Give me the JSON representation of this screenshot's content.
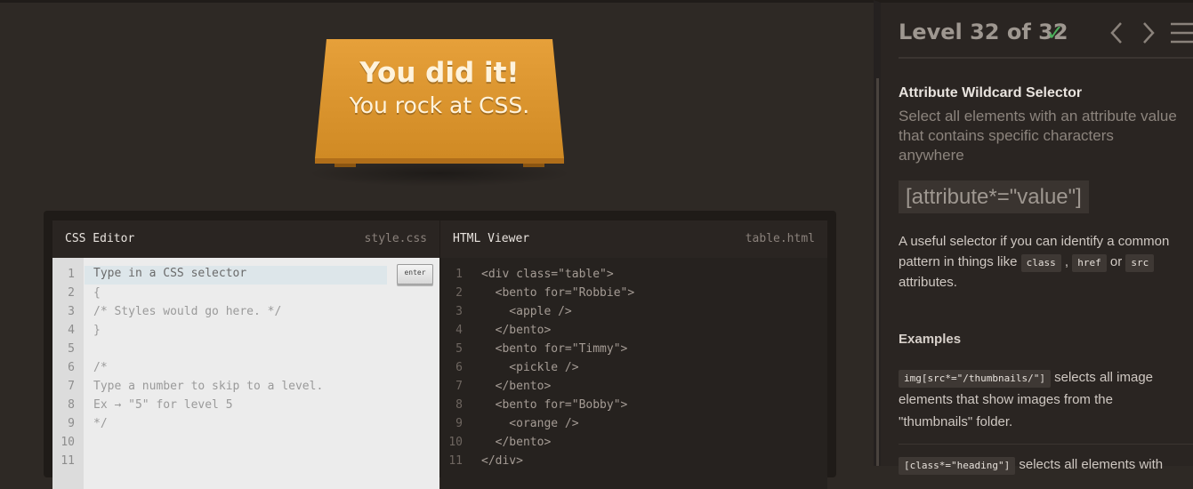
{
  "win": {
    "title": "You did it!",
    "subtitle": "You rock at CSS."
  },
  "css_editor": {
    "title": "CSS Editor",
    "file": "style.css",
    "input_placeholder": "Type in a CSS selector",
    "enter_label": "enter",
    "lines": [
      "{",
      "/* Styles would go here. */",
      "}",
      "",
      "/*",
      "Type a number to skip to a level.",
      "Ex → \"5\" for level 5",
      "*/",
      "",
      ""
    ],
    "line_numbers": [
      "1",
      "2",
      "3",
      "4",
      "5",
      "6",
      "7",
      "8",
      "9",
      "10",
      "11"
    ]
  },
  "html_viewer": {
    "title": "HTML Viewer",
    "file": "table.html",
    "lines": [
      "<div class=\"table\">",
      "  <bento for=\"Robbie\">",
      "    <apple />",
      "  </bento>",
      "  <bento for=\"Timmy\">",
      "    <pickle />",
      "  </bento>",
      "  <bento for=\"Bobby\">",
      "    <orange />",
      "  </bento>",
      "</div>"
    ],
    "line_numbers": [
      "1",
      "2",
      "3",
      "4",
      "5",
      "6",
      "7",
      "8",
      "9",
      "10",
      "11"
    ]
  },
  "sidebar": {
    "level": "Level 32 of 32",
    "title": "Attribute Wildcard Selector",
    "description": "Select all elements with an attribute value that contains specific characters anywhere",
    "syntax": "[attribute*=\"value\"]",
    "help_before": "A useful selector if you can identify a common pattern in things like ",
    "help_tags": [
      "class",
      "href",
      "src"
    ],
    "help_after": "attributes.",
    "examples_heading": "Examples",
    "example1_code": "img[src*=\"/thumbnails/\"]",
    "example1_text": " selects all image elements that show images from the \"thumbnails\" folder.",
    "example2_code": "[class*=\"heading\"]",
    "example2_text": " selects all elements with"
  },
  "colors": {
    "accent_table": "#e09a33",
    "check": "#4cb05c",
    "background": "#2e2925"
  }
}
